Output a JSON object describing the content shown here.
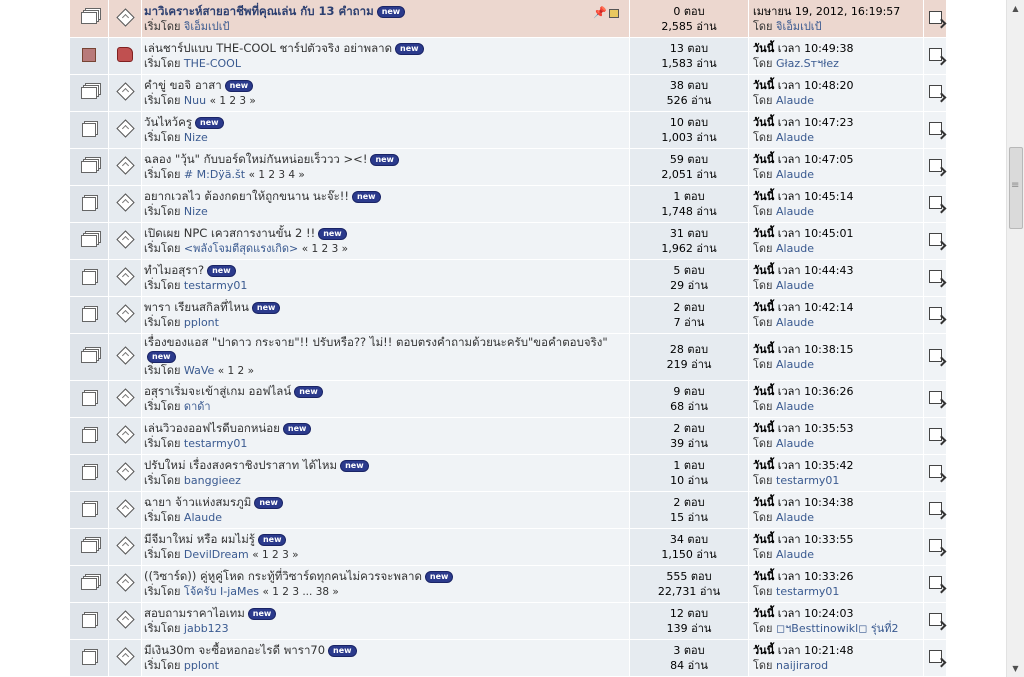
{
  "labels": {
    "started_by": "เริ่มโดย",
    "by": "โดย",
    "today": "วันนี้",
    "time_word": "เวลา",
    "new": "new"
  },
  "topics": [
    {
      "type": "sticky",
      "icon": "announcement-icon",
      "subject": "มาวิเคราะห์สายอาชีพที่คุณเล่น กับ 13 คำถาม",
      "starter": "จิเอ็มเปเป้",
      "pages": "",
      "replies": "0 ตอบ",
      "views": "2,585 อ่าน",
      "last_date": "เมษายน 19, 2012, 16:19:57",
      "last_user": "จิเอ็มเปเป้",
      "today": false
    },
    {
      "type": "row",
      "icon": "poll-icon",
      "subject": "เล่นชาร์ปแบบ THE-COOL ชาร์ปตัวจริง อย่าพลาด",
      "starter": "THE-COOL",
      "pages": "",
      "replies": "13 ตอบ",
      "views": "1,583 อ่าน",
      "last_time": "10:49:38",
      "last_user": "Głaz.Sтฯłez",
      "today": true
    },
    {
      "type": "row",
      "icon": "hot-topic-icon",
      "subject": "คำขู่ ขอจิ อาสา",
      "starter": "Nuu",
      "pages": "« 1 2 3 »",
      "replies": "38 ตอบ",
      "views": "526 อ่าน",
      "last_time": "10:48:20",
      "last_user": "Alaude",
      "today": true
    },
    {
      "type": "row",
      "icon": "topic-icon",
      "subject": "วันไหว้ครู",
      "starter": "Nize",
      "pages": "",
      "replies": "10 ตอบ",
      "views": "1,003 อ่าน",
      "last_time": "10:47:23",
      "last_user": "Alaude",
      "today": true
    },
    {
      "type": "row",
      "icon": "hot-topic-icon",
      "subject": "ฉลอง \"วุ้น\" กับบอร์ดใหม่กันหน่อยเร็ววว ><!",
      "starter": "# M:Dÿä.št",
      "pages": "« 1 2 3 4 »",
      "replies": "59 ตอบ",
      "views": "2,051 อ่าน",
      "last_time": "10:47:05",
      "last_user": "Alaude",
      "today": true
    },
    {
      "type": "row",
      "icon": "topic-icon",
      "subject": "อยากเวลไว ต้องกดยาให้ถูกขนาน นะจ๊ะ!!",
      "starter": "Nize",
      "pages": "",
      "replies": "1 ตอบ",
      "views": "1,748 อ่าน",
      "last_time": "10:45:14",
      "last_user": "Alaude",
      "today": true
    },
    {
      "type": "row",
      "icon": "hot-topic-icon",
      "subject": "เปิดเผย NPC เควสการงานขั้น 2 !!",
      "starter": "<พลังโจมตีสุดแรงเกิด>",
      "pages": "« 1 2 3 »",
      "replies": "31 ตอบ",
      "views": "1,962 อ่าน",
      "last_time": "10:45:01",
      "last_user": "Alaude",
      "today": true
    },
    {
      "type": "row",
      "icon": "topic-icon",
      "subject": "ทำไมอสุรา?",
      "starter": "testarmy01",
      "pages": "",
      "replies": "5 ตอบ",
      "views": "29 อ่าน",
      "last_time": "10:44:43",
      "last_user": "Alaude",
      "today": true
    },
    {
      "type": "row",
      "icon": "topic-icon",
      "subject": "พารา เรียนสกิลที่ไหน",
      "starter": "pplont",
      "pages": "",
      "replies": "2 ตอบ",
      "views": "7 อ่าน",
      "last_time": "10:42:14",
      "last_user": "Alaude",
      "today": true
    },
    {
      "type": "tall",
      "icon": "hot-topic-icon",
      "subject": "เรื่องของแอส \"ปาดาว กระจาย\"!! ปรับหรือ?? ไม่!! ตอบตรงคำถามด้วยนะครับ\"ขอคำตอบจริง\"",
      "starter": "WaVe",
      "pages": "« 1 2 »",
      "replies": "28 ตอบ",
      "views": "219 อ่าน",
      "last_time": "10:38:15",
      "last_user": "Alaude",
      "today": true
    },
    {
      "type": "row",
      "icon": "topic-icon",
      "subject": "อสุราเริ่มจะเข้าสู่เกม ออฟไลน์",
      "starter": "ดาด้า",
      "pages": "",
      "replies": "9 ตอบ",
      "views": "68 อ่าน",
      "last_time": "10:36:26",
      "last_user": "Alaude",
      "today": true
    },
    {
      "type": "row",
      "icon": "topic-icon",
      "subject": "เล่นวิวองออฟไรดีบอกหน่อย",
      "starter": "testarmy01",
      "pages": "",
      "replies": "2 ตอบ",
      "views": "39 อ่าน",
      "last_time": "10:35:53",
      "last_user": "Alaude",
      "today": true
    },
    {
      "type": "row",
      "icon": "topic-icon",
      "subject": "ปรับใหม่ เรื่องสงคราชิงปราสาท ได้ไหม",
      "starter": "banggieez",
      "pages": "",
      "replies": "1 ตอบ",
      "views": "10 อ่าน",
      "last_time": "10:35:42",
      "last_user": "testarmy01",
      "today": true
    },
    {
      "type": "row",
      "icon": "topic-icon",
      "subject": "ฉายา จ้าวแห่งสมรภูมิ",
      "starter": "Alaude",
      "pages": "",
      "replies": "2 ตอบ",
      "views": "15 อ่าน",
      "last_time": "10:34:38",
      "last_user": "Alaude",
      "today": true
    },
    {
      "type": "row",
      "icon": "hot-topic-icon",
      "subject": "มีจีมาใหม่ หรือ ผมไม่รู้",
      "starter": "DevilDream",
      "pages": "« 1 2 3 »",
      "replies": "34 ตอบ",
      "views": "1,150 อ่าน",
      "last_time": "10:33:55",
      "last_user": "Alaude",
      "today": true
    },
    {
      "type": "row",
      "icon": "hot-topic-icon",
      "subject": "((วิซาร์ด)) คู่หูคู่โหด กระทู้ที่วิซาร์ดทุกคนไม่ควรจะพลาด",
      "starter": "โจ้ครับ I-jaMes",
      "pages": "« 1 2 3 ... 38 »",
      "replies": "555 ตอบ",
      "views": "22,731 อ่าน",
      "last_time": "10:33:26",
      "last_user": "testarmy01",
      "today": true
    },
    {
      "type": "row",
      "icon": "topic-icon",
      "subject": "สอบถามราคาไอเทม",
      "starter": "jabb123",
      "pages": "",
      "replies": "12 ตอบ",
      "views": "139 อ่าน",
      "last_time": "10:24:03",
      "last_user": "◻︎ฯBesttinowikl◻︎ รุ่นที่2",
      "today": true
    },
    {
      "type": "row",
      "icon": "topic-icon",
      "subject": "มีเงิน30m จะซื้อหอกอะไรดี พารา70",
      "starter": "pplont",
      "pages": "",
      "replies": "3 ตอบ",
      "views": "84 อ่าน",
      "last_time": "10:21:48",
      "last_user": "naijirarod",
      "today": true
    }
  ]
}
